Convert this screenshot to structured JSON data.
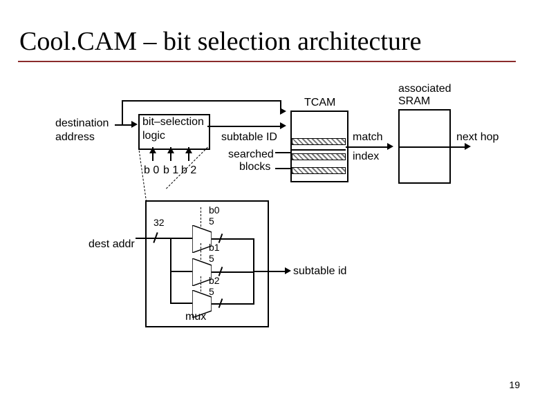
{
  "title": "Cool.CAM – bit selection architecture",
  "page_number": "19",
  "labels": {
    "destination": "destination",
    "address": "address",
    "bit_selection": "bit–selection",
    "logic": "logic",
    "b0": "b 0",
    "b1": "b 1",
    "b2": "b 2",
    "subtable_id_top": "subtable ID",
    "searched": "searched",
    "blocks": "blocks",
    "tcam": "TCAM",
    "match": "match",
    "index": "index",
    "associated": "associated",
    "sram": "SRAM",
    "next_hop": "next hop",
    "dest_addr": "dest addr",
    "thirty_two": "32",
    "five_a": "5",
    "five_b": "5",
    "five_c": "5",
    "b0_low": "b0",
    "b1_low": "b1",
    "b2_low": "b2",
    "mux": "mux",
    "subtable_id_low": "subtable id"
  }
}
